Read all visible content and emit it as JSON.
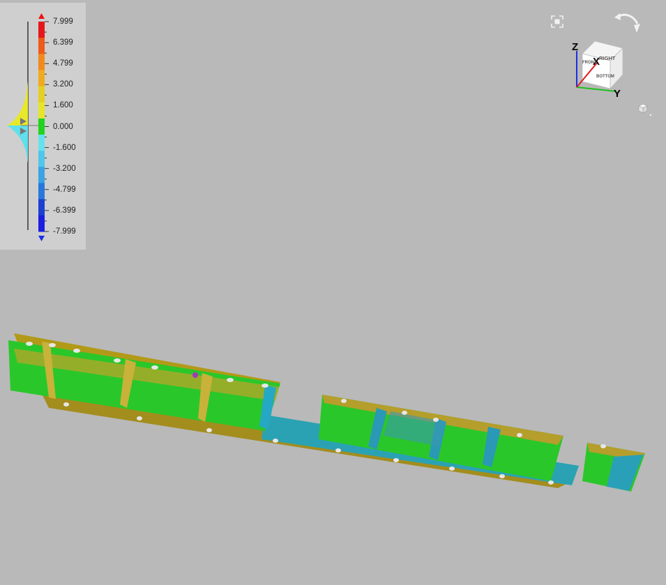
{
  "legend": {
    "ticks": [
      "7.999",
      "6.399",
      "4.799",
      "3.200",
      "1.600",
      "0.000",
      "-1.600",
      "-3.200",
      "-4.799",
      "-6.399",
      "-7.999"
    ],
    "band_colors": [
      "#e4161b",
      "#ee5a18",
      "#f18a1c",
      "#efab1f",
      "#e4cf22",
      "#e7e528",
      "#21d31f",
      "#66e1ed",
      "#4fc6ea",
      "#3aa3e4",
      "#2878dc",
      "#1c3fd2",
      "#1a1ee0"
    ],
    "over_arrow_color": "#ee1111",
    "under_arrow_color": "#1a2ee6"
  },
  "view_cube": {
    "faces": {
      "right": "RIGHT",
      "front": "FRONT",
      "bottom": "BOTTOM"
    },
    "axes": {
      "z": "Z",
      "x": "X",
      "y": "Y"
    },
    "axis_colors": {
      "z": "#1a2fe0",
      "x": "#e01a1a",
      "y": "#1fbf1f"
    }
  },
  "icons": {
    "fit": "fit-view-icon",
    "rotate": "rotate-view-icon",
    "view_cube": "view-cube-icon",
    "small_cube": "cube-menu-icon"
  }
}
